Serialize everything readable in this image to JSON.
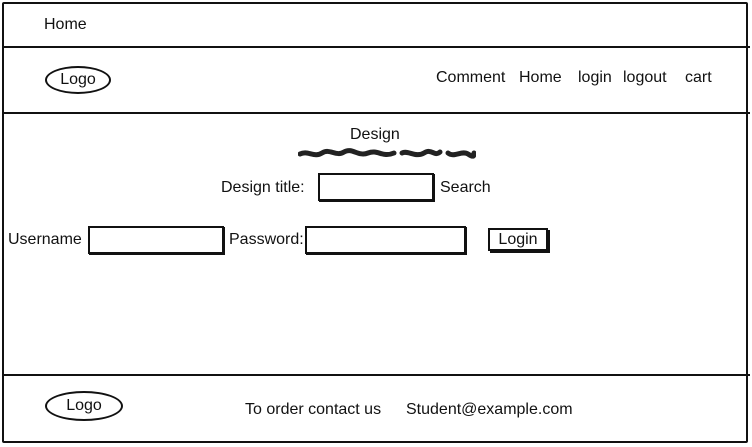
{
  "topbar": {
    "home_label": "Home"
  },
  "header": {
    "logo_label": "Logo",
    "nav": [
      "Comment",
      "Home",
      "login",
      "logout",
      "cart"
    ]
  },
  "main": {
    "heading": "Design",
    "search": {
      "label": "Design title:",
      "value": "",
      "button_label": "Search"
    },
    "login_form": {
      "username_label": "Username",
      "username_value": "",
      "password_label": "Password:",
      "password_value": "",
      "login_button": "Login"
    }
  },
  "footer": {
    "logo_label": "Logo",
    "contact_text": "To order contact us",
    "email": "Student@example.com"
  }
}
